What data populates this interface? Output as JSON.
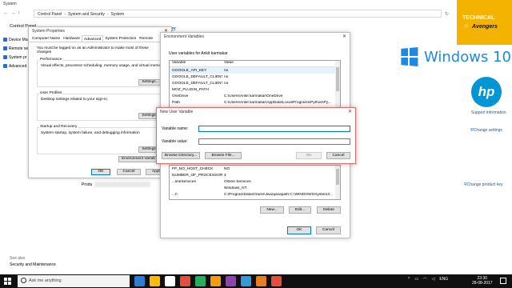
{
  "control_panel": {
    "window_title": "System",
    "breadcrumbs": [
      "Control Panel",
      "System and Security",
      "System"
    ],
    "left_title": "Control Panel",
    "left_links": [
      "Device Ma",
      "Remote se",
      "System pr",
      "Advanced"
    ],
    "see_also": "See also",
    "security_maintenance": "Security and Maintenance",
    "header_fragment": "er",
    "product_label": "Produ",
    "support_link": "Support information",
    "change_settings": "Change settings",
    "change_product_key": "Change product key"
  },
  "branding": {
    "windows_text": "Windows 10",
    "hp_text": "hp",
    "overlay_line1": "TECHNICAL",
    "overlay_line2": "Avengers"
  },
  "system_properties": {
    "title": "System Properties",
    "tabs": [
      "Computer Name",
      "Hardware",
      "Advanced",
      "System Protection",
      "Remote"
    ],
    "active_tab": "Advanced",
    "admin_note": "You must be logged on as an Administrator to make most of these changes",
    "performance": {
      "title": "Performance",
      "desc": "Visual effects, processor scheduling, memory usage, and virtual memory",
      "button": "Settings..."
    },
    "user_profiles": {
      "title": "User Profiles",
      "desc": "Desktop settings related to your sign-in",
      "button": "Settings..."
    },
    "startup_recovery": {
      "title": "Startup and Recovery",
      "desc": "System startup, system failure, and debugging information",
      "button": "Settings..."
    },
    "env_button": "Environment Variab",
    "ok": "OK",
    "cancel": "Cancel",
    "apply": "Apply"
  },
  "env_vars": {
    "title": "Environment Variables",
    "user_label": "User variables for Ankit karmakar",
    "columns": [
      "Variable",
      "Value"
    ],
    "user_rows": [
      [
        "GOOGLE_API_KEY",
        "no"
      ],
      [
        "GOOGLE_DEFAULT_CLIENT...",
        "no"
      ],
      [
        "GOOGLE_DEFAULT_CLIENT...",
        "no"
      ],
      [
        "MOZ_PLUGIN_PATH",
        ""
      ],
      [
        "OneDrive",
        "C:\\Users\\Ankit karmakar\\OneDrive"
      ],
      [
        "Path",
        "C:\\Users\\Ankit karmakar\\AppData\\Local\\Programs\\Python\\Py..."
      ]
    ],
    "system_rows": [
      [
        "FP_NO_HOST_CHECK",
        "NO"
      ],
      [
        "NUMBER_OF_PROCESSORS",
        "4"
      ],
      [
        "...lineServices",
        "Online Services"
      ],
      [
        "",
        "Windows_NT"
      ],
      [
        "...h",
        "C:\\ProgramData\\Oracle\\Java\\javapath;C:\\WINDOWS\\system3..."
      ]
    ],
    "new_button": "New...",
    "edit_button": "Edit...",
    "delete_button": "Delete",
    "ok": "OK",
    "cancel": "Cancel"
  },
  "new_user_variable": {
    "title": "New User Variable",
    "name_label": "Variable name:",
    "value_label": "Variable value:",
    "name_value": "",
    "value_value": "",
    "browse_directory": "Browse Directory...",
    "browse_file": "Browse File...",
    "ok": "OK",
    "cancel": "Cancel"
  },
  "taskbar": {
    "search_placeholder": "Ask me anything",
    "language": "ENG",
    "time": "23:30",
    "date": "28-08-2017",
    "icon_colors": [
      "#2d7dd2",
      "#ffb900",
      "#ffffff",
      "#e74c3c",
      "#27ae60",
      "#f39c12",
      "#8e44ad",
      "#3498db",
      "#e67e22",
      "#e74c3c"
    ]
  }
}
